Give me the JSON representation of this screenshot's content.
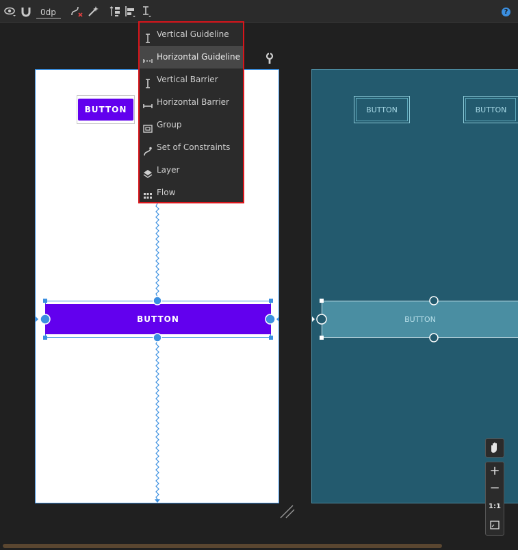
{
  "toolbar": {
    "margin_value": "0dp",
    "icons": [
      "eye-icon",
      "magnet-icon",
      "clear-constraints-icon",
      "infer-constraints-icon",
      "pack-icon",
      "align-icon",
      "guidelines-icon"
    ],
    "help": "?"
  },
  "menu": {
    "items": [
      {
        "label": "Vertical Guideline",
        "icon": "vertical-guideline-icon",
        "active": false
      },
      {
        "label": "Horizontal Guideline",
        "icon": "horizontal-guideline-icon",
        "active": true
      },
      {
        "label": "Vertical Barrier",
        "icon": "vertical-barrier-icon",
        "active": false
      },
      {
        "label": "Horizontal Barrier",
        "icon": "horizontal-barrier-icon",
        "active": false
      },
      {
        "label": "Group",
        "icon": "group-icon",
        "active": false
      },
      {
        "label": "Set of Constraints",
        "icon": "set-of-constraints-icon",
        "active": false
      },
      {
        "label": "Layer",
        "icon": "layer-icon",
        "active": false
      },
      {
        "label": "Flow",
        "icon": "flow-icon",
        "active": false
      }
    ]
  },
  "design": {
    "button_top": "BUTTON",
    "button_wide": "BUTTON"
  },
  "blueprint": {
    "button_left": "BUTTON",
    "button_right": "BUTTON",
    "button_wide": "BUTTON"
  },
  "zoom": {
    "zoom_in": "+",
    "zoom_out": "−",
    "one_to_one": "1:1"
  },
  "colors": {
    "accent": "#3b8fe0",
    "button": "#6200ee",
    "blueprint": "#235a6e",
    "menu_border": "#d9151b"
  }
}
